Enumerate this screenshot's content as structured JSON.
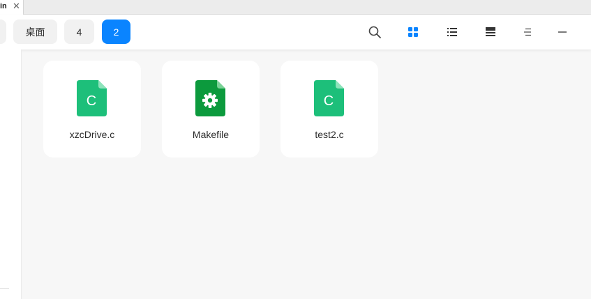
{
  "tab": {
    "label": "in",
    "close_glyph": "✕"
  },
  "breadcrumb": [
    {
      "label": "",
      "active": false
    },
    {
      "label": "桌面",
      "active": false
    },
    {
      "label": "4",
      "active": false
    },
    {
      "label": "2",
      "active": true
    }
  ],
  "toolbar_icons": [
    "search-icon",
    "grid-view-icon",
    "list-view-icon",
    "tree-view-icon",
    "menu-icon",
    "minimize-icon"
  ],
  "colors": {
    "accent": "#0a84ff",
    "c_file": "#1dbf7a",
    "makefile": "#0c9a3d"
  },
  "files": [
    {
      "name": "xzcDrive.c",
      "icon": "c-file-icon",
      "glyph": "C"
    },
    {
      "name": "Makefile",
      "icon": "makefile-icon",
      "glyph": ""
    },
    {
      "name": "test2.c",
      "icon": "c-file-icon",
      "glyph": "C"
    }
  ]
}
